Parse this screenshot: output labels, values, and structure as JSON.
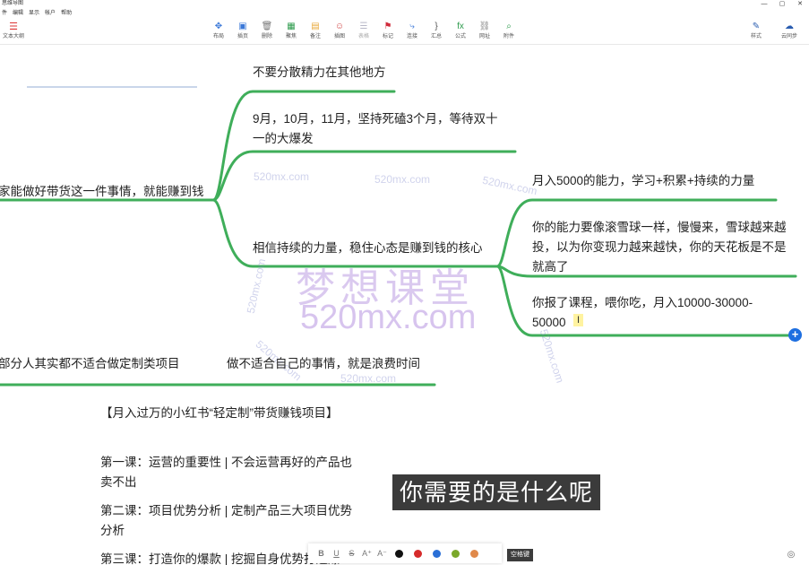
{
  "window": {
    "title": "思维导图",
    "controls": [
      "—",
      "▢",
      "✕"
    ]
  },
  "menu": [
    "件",
    "编辑",
    "显示",
    "帐户",
    "帮助"
  ],
  "toolbar": {
    "outline": "文本大纲",
    "tools": [
      {
        "label": "布局",
        "icon": "move-icon",
        "color": "#3a78d8",
        "glyph": "✥",
        "dim": false
      },
      {
        "label": "插页",
        "icon": "insert-icon",
        "color": "#3a78d8",
        "glyph": "▣",
        "dim": false
      },
      {
        "label": "删除",
        "icon": "trash-icon",
        "color": "#777777",
        "glyph": "🗑",
        "dim": false
      },
      {
        "label": "聚焦",
        "icon": "image-icon",
        "color": "#2e9b4d",
        "glyph": "▦",
        "dim": false
      },
      {
        "label": "备注",
        "icon": "note-icon",
        "color": "#e8a83a",
        "glyph": "▤",
        "dim": false
      },
      {
        "label": "插图",
        "icon": "sticker-icon",
        "color": "#d04444",
        "glyph": "☺",
        "dim": false
      },
      {
        "label": "表格",
        "icon": "table-icon",
        "color": "#b8b8c8",
        "glyph": "☰",
        "dim": true
      },
      {
        "label": "标记",
        "icon": "flag-icon",
        "color": "#d02c3c",
        "glyph": "⚑",
        "dim": false
      },
      {
        "label": "连接",
        "icon": "connect-icon",
        "color": "#3a78d8",
        "glyph": "⤷",
        "dim": false
      },
      {
        "label": "汇总",
        "icon": "brace-icon",
        "color": "#555555",
        "glyph": "}",
        "dim": false
      },
      {
        "label": "公式",
        "icon": "formula-icon",
        "color": "#2e9b4d",
        "glyph": "fx",
        "dim": false
      },
      {
        "label": "网址",
        "icon": "link-icon",
        "color": "#888888",
        "glyph": "⛓",
        "dim": false
      },
      {
        "label": "附件",
        "icon": "attach-icon",
        "color": "#2e9b4d",
        "glyph": "⌕",
        "dim": false
      }
    ],
    "right": [
      {
        "label": "样式",
        "icon": "style-brush-icon",
        "glyph": "✎"
      },
      {
        "label": "云同步",
        "icon": "cloud-sync-icon",
        "glyph": "☁"
      }
    ]
  },
  "mindmap": {
    "root_top": "家能做好带货这一件事情，就能赚到钱",
    "branch_1": "不要分散精力在其他地方",
    "branch_2": "9月，10月，11月，坚持死磕3个月，等待双十一的大爆发",
    "branch_3": "相信持续的力量，稳住心态是赚到钱的核心",
    "sub_1": "月入5000的能力，学习+积累+持续的力量",
    "sub_2": "你的能力要像滚雪球一样，慢慢来，雪球越来越投，以为你变现力越来越快，你的天花板是不是就高了",
    "sub_3": "你报了课程，喂你吃，月入10000-30000-50000",
    "root_bottom": "部分人其实都不适合做定制类项目",
    "branch_bottom": "做不适合自己的事情，就是浪费时间",
    "line_color": "#3fae5a"
  },
  "document": {
    "heading": "【月入过万的小红书“轻定制”带货赚钱项目】",
    "lesson_1": "第一课：运营的重要性 | 不会运营再好的产品也卖不出",
    "lesson_2": "第二课：项目优势分析 | 定制产品三大项目优势分析",
    "lesson_3": "第三课：打造你的爆款 | 挖掘自身优势打造爆"
  },
  "watermark": {
    "big": "梦想课堂",
    "domain": "520mx.com",
    "small": "520mx.com"
  },
  "subtitle": "你需要的是什么呢",
  "format_bar": {
    "bold": "B",
    "underline": "U",
    "strike": "S",
    "grow": "A⁺",
    "shrink": "A⁻",
    "colors": [
      "#111111",
      "#d62b2b",
      "#2a6fd6",
      "#7aa82a",
      "#e0894a"
    ]
  },
  "shortcut_badge": "空格键",
  "cursor_glyph": "I",
  "add_glyph": "+",
  "help_glyph": "◎"
}
